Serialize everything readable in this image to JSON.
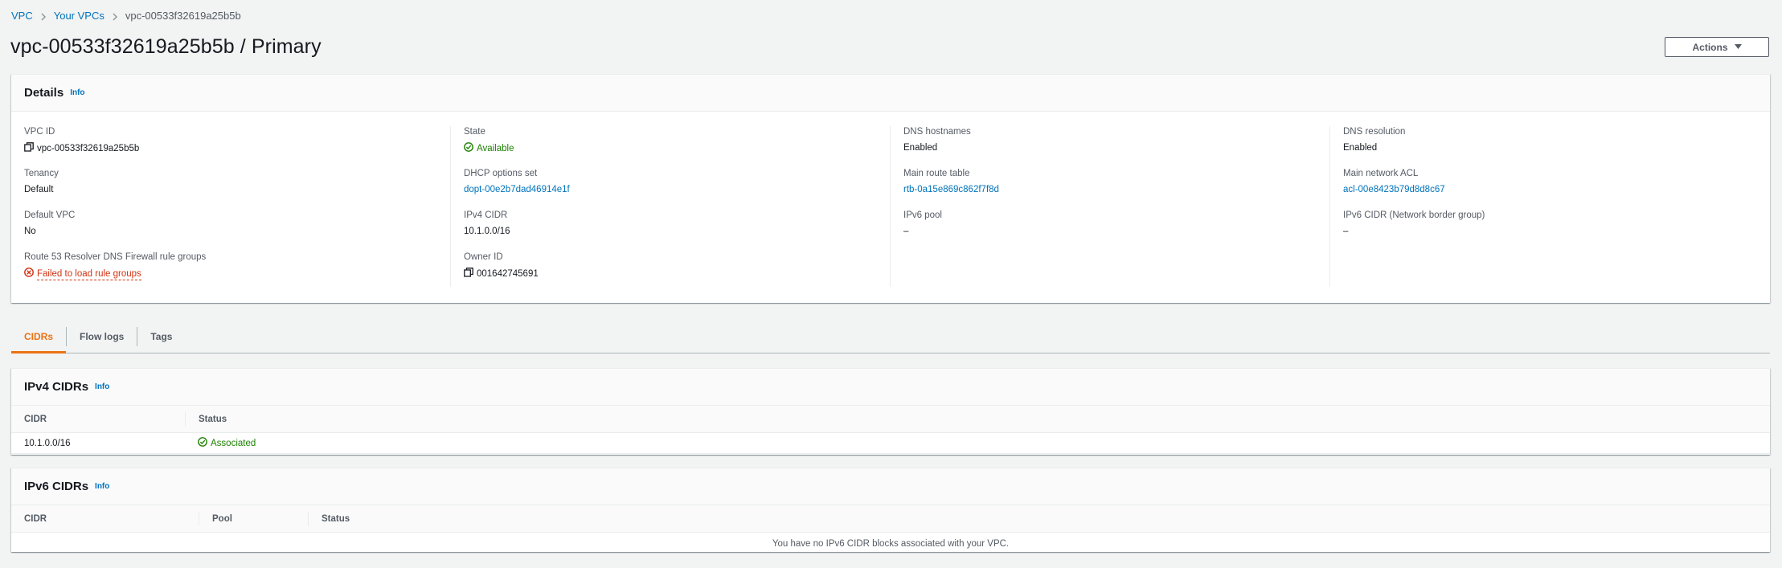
{
  "breadcrumb": {
    "items": [
      "VPC",
      "Your VPCs"
    ],
    "current": "vpc-00533f32619a25b5b"
  },
  "page": {
    "title": "vpc-00533f32619a25b5b / Primary",
    "actions_label": "Actions"
  },
  "details": {
    "title": "Details",
    "info_label": "Info",
    "col1": {
      "vpc_id_label": "VPC ID",
      "vpc_id_value": "vpc-00533f32619a25b5b",
      "tenancy_label": "Tenancy",
      "tenancy_value": "Default",
      "default_vpc_label": "Default VPC",
      "default_vpc_value": "No",
      "r53_label": "Route 53 Resolver DNS Firewall rule groups",
      "r53_value": "Failed to load rule groups"
    },
    "col2": {
      "state_label": "State",
      "state_value": "Available",
      "dhcp_label": "DHCP options set",
      "dhcp_value": "dopt-00e2b7dad46914e1f",
      "ipv4_label": "IPv4 CIDR",
      "ipv4_value": "10.1.0.0/16",
      "owner_label": "Owner ID",
      "owner_value": "001642745691"
    },
    "col3": {
      "dns_hostnames_label": "DNS hostnames",
      "dns_hostnames_value": "Enabled",
      "main_rt_label": "Main route table",
      "main_rt_value": "rtb-0a15e869c862f7f8d",
      "ipv6_pool_label": "IPv6 pool",
      "ipv6_pool_value": "–"
    },
    "col4": {
      "dns_resolution_label": "DNS resolution",
      "dns_resolution_value": "Enabled",
      "main_acl_label": "Main network ACL",
      "main_acl_value": "acl-00e8423b79d8d8c67",
      "ipv6_cidr_label": "IPv6 CIDR (Network border group)",
      "ipv6_cidr_value": "–"
    }
  },
  "tabs": [
    {
      "label": "CIDRs",
      "active": true
    },
    {
      "label": "Flow logs",
      "active": false
    },
    {
      "label": "Tags",
      "active": false
    }
  ],
  "ipv4_cidrs": {
    "title": "IPv4 CIDRs",
    "info_label": "Info",
    "columns": [
      "CIDR",
      "Status"
    ],
    "rows": [
      {
        "cidr": "10.1.0.0/16",
        "status": "Associated"
      }
    ]
  },
  "ipv6_cidrs": {
    "title": "IPv6 CIDRs",
    "info_label": "Info",
    "columns": [
      "CIDR",
      "Pool",
      "Status"
    ],
    "empty_message": "You have no IPv6 CIDR blocks associated with your VPC."
  },
  "colors": {
    "link": "#0073bb",
    "success": "#1d8102",
    "error": "#d13212",
    "tab_active": "#ec7211"
  }
}
